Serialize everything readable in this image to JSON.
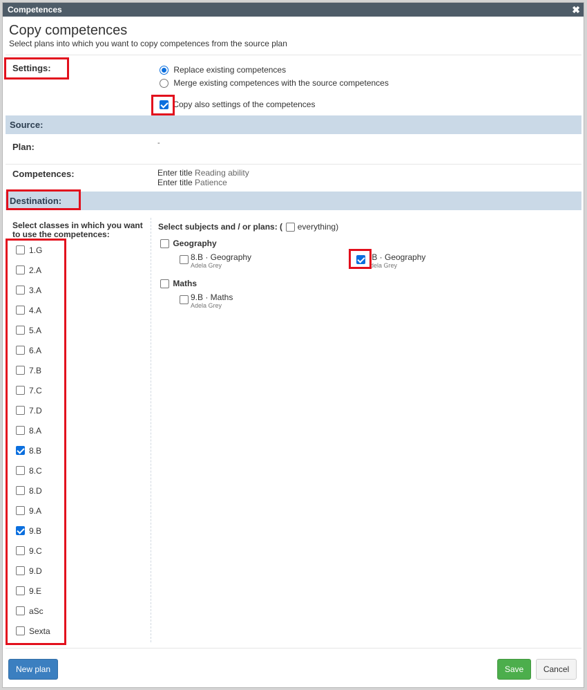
{
  "window": {
    "title": "Competences",
    "close_glyph": "✖"
  },
  "header": {
    "title": "Copy competences",
    "subtitle": "Select plans into which you want to copy competences from the source plan"
  },
  "settings": {
    "label": "Settings:",
    "radio_replace": "Replace existing competences",
    "radio_merge": "Merge existing competences with the source competences",
    "radio_selected": "replace",
    "copy_settings_label": "Copy also settings of the competences",
    "copy_settings_checked": true
  },
  "source": {
    "band_label": "Source:",
    "plan_label": "Plan:",
    "plan_value": "-",
    "competences_label": "Competences:",
    "competences": [
      {
        "prefix": "Enter title",
        "title": "Reading ability"
      },
      {
        "prefix": "Enter title",
        "title": "Patience"
      }
    ]
  },
  "destination": {
    "band_label": "Destination:",
    "classes_label": "Select classes in which you want to use the competences:",
    "classes": [
      {
        "name": "1.G",
        "checked": false
      },
      {
        "name": "2.A",
        "checked": false
      },
      {
        "name": "3.A",
        "checked": false
      },
      {
        "name": "4.A",
        "checked": false
      },
      {
        "name": "5.A",
        "checked": false
      },
      {
        "name": "6.A",
        "checked": false
      },
      {
        "name": "7.B",
        "checked": false
      },
      {
        "name": "7.C",
        "checked": false
      },
      {
        "name": "7.D",
        "checked": false
      },
      {
        "name": "8.A",
        "checked": false
      },
      {
        "name": "8.B",
        "checked": true
      },
      {
        "name": "8.C",
        "checked": false
      },
      {
        "name": "8.D",
        "checked": false
      },
      {
        "name": "9.A",
        "checked": false
      },
      {
        "name": "9.B",
        "checked": true
      },
      {
        "name": "9.C",
        "checked": false
      },
      {
        "name": "9.D",
        "checked": false
      },
      {
        "name": "9.E",
        "checked": false
      },
      {
        "name": "aSc",
        "checked": false
      },
      {
        "name": "Sexta",
        "checked": false
      }
    ],
    "subjects_label": "Select subjects and / or plans: (",
    "everything_label": "everything)",
    "subjects": [
      {
        "name": "Geography",
        "plans": [
          {
            "name": "8.B · Geography",
            "teacher": "Adela Grey",
            "checked": false
          },
          {
            "name": ".B · Geography",
            "teacher": "dela Grey",
            "checked": true
          }
        ]
      },
      {
        "name": "Maths",
        "plans": [
          {
            "name": "9.B · Maths",
            "teacher": "Adela Grey",
            "checked": false
          }
        ]
      }
    ]
  },
  "footer": {
    "new_plan": "New plan",
    "save": "Save",
    "cancel": "Cancel"
  },
  "colors": {
    "titlebar": "#4e5c68",
    "band": "#cad9e7",
    "highlight": "#e2101d",
    "accent": "#0b6fde"
  }
}
